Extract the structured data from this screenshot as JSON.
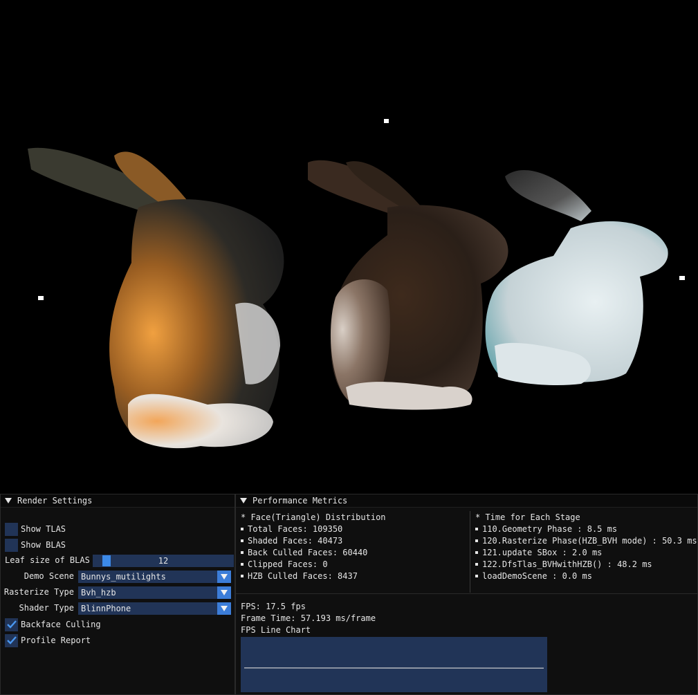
{
  "render_settings": {
    "title": "Render Settings",
    "show_tlas": {
      "label": "Show TLAS",
      "checked": false
    },
    "show_blas": {
      "label": "Show BLAS",
      "checked": false
    },
    "leaf_size": {
      "label": "Leaf size of BLAS",
      "value": "12"
    },
    "demo_scene": {
      "label": "Demo Scene",
      "value": "Bunnys_mutilights"
    },
    "rasterize_type": {
      "label": "Rasterize Type",
      "value": "Bvh_hzb"
    },
    "shader_type": {
      "label": "Shader Type",
      "value": "BlinnPhone"
    },
    "backface_culling": {
      "label": "Backface Culling",
      "checked": true
    },
    "profile_report": {
      "label": "Profile Report",
      "checked": true
    }
  },
  "performance": {
    "title": "Performance Metrics",
    "faces": {
      "header": "* Face(Triangle) Distribution",
      "items": [
        "Total Faces: 109350",
        "Shaded Faces: 40473",
        "Back Culled Faces: 60440",
        "Clipped Faces: 0",
        "HZB Culled Faces: 8437"
      ]
    },
    "stages": {
      "header": "* Time for Each Stage",
      "items": [
        "110.Geometry Phase : 8.5 ms",
        "120.Rasterize Phase(HZB_BVH mode) : 50.3 ms",
        "121.update SBox : 2.0 ms",
        "122.DfsTlas_BVHwithHZB() : 48.2 ms",
        "loadDemoScene : 0.0 ms"
      ]
    },
    "fps": "FPS: 17.5 fps",
    "frame_time": "Frame Time: 57.193 ms/frame",
    "chart_label": "FPS Line Chart"
  },
  "colors": {
    "widget_bg": "#213457",
    "accent": "#3c7dd8",
    "panel_bg": "#0f0f0f"
  },
  "chart_data": {
    "type": "line",
    "title": "",
    "series": [
      {
        "values": [
          17.6,
          17.55,
          17.5,
          17.45,
          17.4
        ]
      }
    ],
    "ylim": [
      0,
      40
    ]
  }
}
